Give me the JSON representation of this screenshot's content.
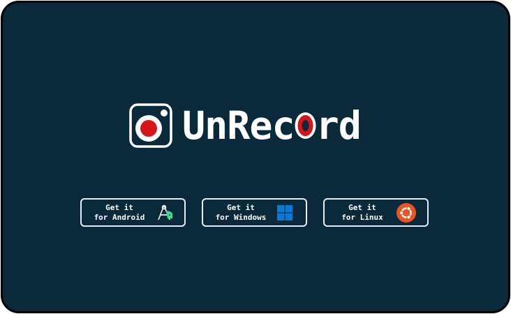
{
  "brand": {
    "name_part1": "UnRec",
    "name_part2": "rd",
    "highlight_letter": "o",
    "accent_color": "#d7141a",
    "background_color": "#0a2a3c"
  },
  "downloads": [
    {
      "line1": "Get it",
      "line2": "for Android",
      "icon": "android-studio-icon"
    },
    {
      "line1": "Get it",
      "line2": "for Windows",
      "icon": "windows-icon",
      "icon_color": "#0a78d4"
    },
    {
      "line1": "Get it",
      "line2": "for Linux",
      "icon": "ubuntu-icon",
      "icon_color": "#e95420"
    }
  ]
}
